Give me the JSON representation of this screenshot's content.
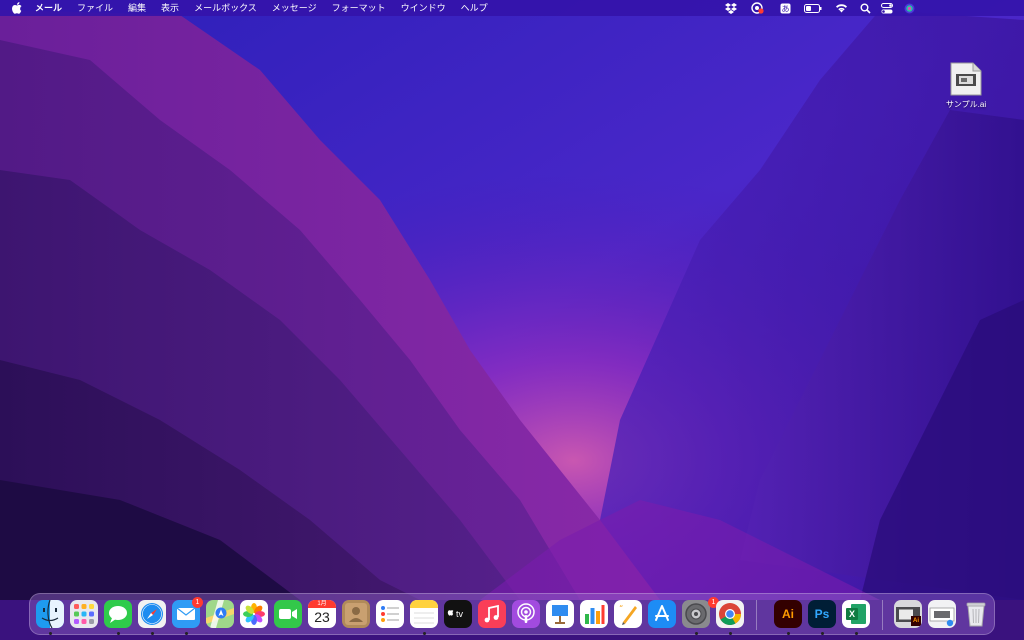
{
  "menubar": {
    "app_name": "メール",
    "items": [
      "ファイル",
      "編集",
      "表示",
      "メールボックス",
      "メッセージ",
      "フォーマット",
      "ウインドウ",
      "ヘルプ"
    ]
  },
  "desktop": {
    "files": [
      {
        "name": "サンプル.ai",
        "icon": "file-icon"
      }
    ]
  },
  "dock": {
    "apps": [
      {
        "name": "finder",
        "running": true
      },
      {
        "name": "launchpad",
        "running": false
      },
      {
        "name": "messages",
        "running": true
      },
      {
        "name": "safari",
        "running": true
      },
      {
        "name": "mail",
        "running": true,
        "badge": "1"
      },
      {
        "name": "maps",
        "running": false
      },
      {
        "name": "photos",
        "running": false
      },
      {
        "name": "facetime",
        "running": false
      },
      {
        "name": "calendar",
        "running": false,
        "month": "1月",
        "day": "23"
      },
      {
        "name": "contacts",
        "running": false
      },
      {
        "name": "reminders",
        "running": false
      },
      {
        "name": "notes",
        "running": true
      },
      {
        "name": "apple-tv",
        "running": false,
        "label": "tv"
      },
      {
        "name": "music",
        "running": false
      },
      {
        "name": "podcasts",
        "running": false
      },
      {
        "name": "keynote",
        "running": false
      },
      {
        "name": "numbers",
        "running": false
      },
      {
        "name": "pages",
        "running": false
      },
      {
        "name": "app-store",
        "running": false
      },
      {
        "name": "system-preferences",
        "running": true,
        "badge": "1"
      },
      {
        "name": "chrome",
        "running": true
      },
      {
        "name": "illustrator",
        "running": true,
        "label": "Ai"
      },
      {
        "name": "photoshop",
        "running": true,
        "label": "Ps"
      },
      {
        "name": "excel",
        "running": true,
        "label": "X"
      },
      {
        "name": "recent-ai-document",
        "running": false,
        "label": "Ai"
      },
      {
        "name": "recent-document",
        "running": false
      },
      {
        "name": "trash",
        "running": false
      }
    ]
  },
  "colors": {
    "menubar_bg": "#3414aa",
    "accent_purple": "#6b1fc7",
    "badge_red": "#ff3b30"
  }
}
